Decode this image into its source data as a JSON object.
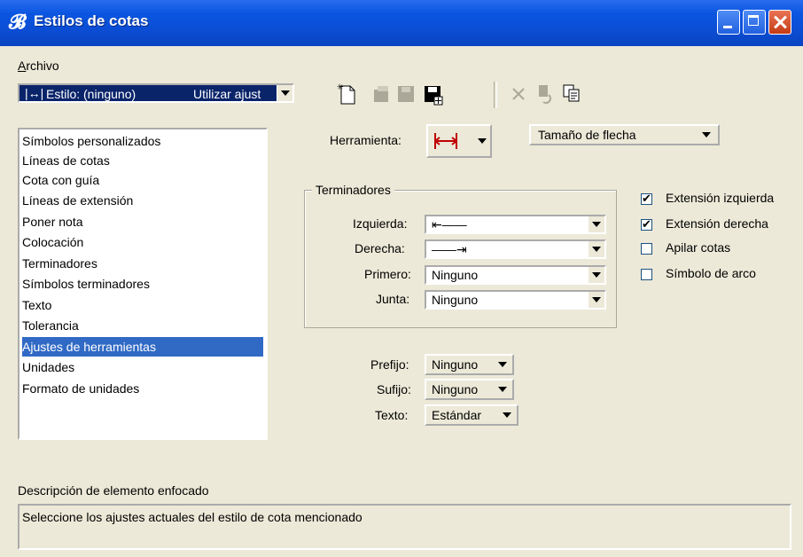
{
  "window": {
    "title": "Estilos de cotas",
    "app_icon": "microstation-icon"
  },
  "menu": {
    "archivo": "Archivo"
  },
  "style_combo": {
    "label": "Estilo: (ninguno)",
    "option": "Utilizar ajust"
  },
  "categories": [
    "Símbolos personalizados",
    "Líneas de cotas",
    "Cota con guía",
    "Líneas de extensión",
    "Poner nota",
    "Colocación",
    "Terminadores",
    "Símbolos terminadores",
    "Texto",
    "Tolerancia",
    "Ajustes de herramientas",
    "Unidades",
    "Formato de unidades"
  ],
  "selected_category": "Ajustes de herramientas",
  "tool": {
    "label": "Herramienta:",
    "size_combo": "Tamaño de flecha"
  },
  "terminators": {
    "title": "Terminadores",
    "izquierda": {
      "label": "Izquierda:",
      "value": "⇤——"
    },
    "derecha": {
      "label": "Derecha:",
      "value": "——⇥"
    },
    "primero": {
      "label": "Primero:",
      "value": "Ninguno"
    },
    "junta": {
      "label": "Junta:",
      "value": "Ninguno"
    }
  },
  "checks": {
    "ext_izq": {
      "label": "Extensión izquierda",
      "checked": true
    },
    "ext_der": {
      "label": "Extensión derecha",
      "checked": true
    },
    "apilar": {
      "label": "Apilar cotas",
      "checked": false
    },
    "arco": {
      "label": "Símbolo de arco",
      "checked": false
    }
  },
  "text_opts": {
    "prefijo": {
      "label": "Prefijo:",
      "value": "Ninguno"
    },
    "sufijo": {
      "label": "Sufijo:",
      "value": "Ninguno"
    },
    "texto": {
      "label": "Texto:",
      "value": "Estándar"
    }
  },
  "description": {
    "title": "Descripción de elemento enfocado",
    "text": "Seleccione los ajustes actuales del estilo de cota mencionado"
  },
  "colors": {
    "titlebar": "#0a55e0",
    "selection": "#316ac5",
    "face": "#ece9d8"
  }
}
